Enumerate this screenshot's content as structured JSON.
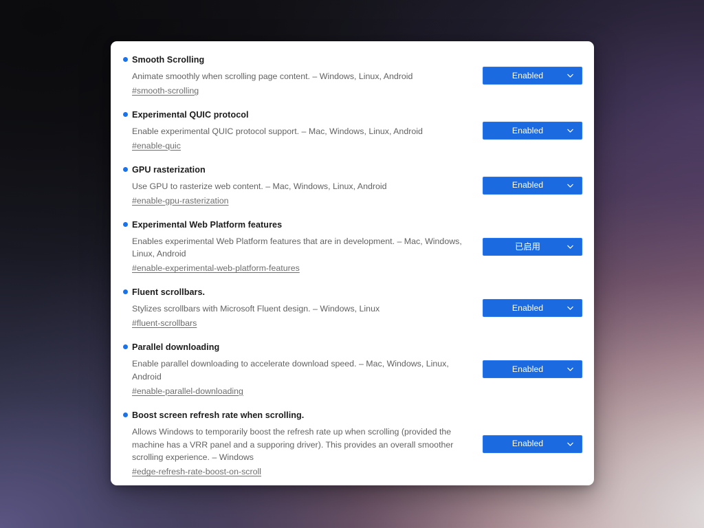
{
  "window": {
    "app": "browser-flags-page",
    "card_background": "#ffffff",
    "accent_blue": "#1b6ae0",
    "bullet_blue": "#1a73e8"
  },
  "wallpaper": {
    "name": "windows-bloom-wallpaper",
    "colors": {
      "top_left": "#141417",
      "bottom_left": "#66609 4",
      "bottom_right": "#fffcfa",
      "mid_right": "#96688c"
    }
  },
  "flags": [
    {
      "title": "Smooth Scrolling",
      "description": "Animate smoothly when scrolling page content. – Windows, Linux, Android",
      "link": "#smooth-scrolling",
      "value": "Enabled",
      "select_name": "smooth-scrolling-select"
    },
    {
      "title": "Experimental QUIC protocol",
      "description": "Enable experimental QUIC protocol support. – Mac, Windows, Linux, Android",
      "link": "#enable-quic",
      "value": "Enabled",
      "select_name": "enable-quic-select"
    },
    {
      "title": "GPU rasterization",
      "description": "Use GPU to rasterize web content. – Mac, Windows, Linux, Android",
      "link": "#enable-gpu-rasterization",
      "value": "Enabled",
      "select_name": "enable-gpu-rasterization-select"
    },
    {
      "title": "Experimental Web Platform features",
      "description": "Enables experimental Web Platform features that are in development. – Mac, Windows, Linux, Android",
      "link": "#enable-experimental-web-platform-features",
      "value": "已启用",
      "select_name": "enable-experimental-web-platform-features-select"
    },
    {
      "title": "Fluent scrollbars.",
      "description": "Stylizes scrollbars with Microsoft Fluent design. – Windows, Linux",
      "link": "#fluent-scrollbars",
      "value": "Enabled",
      "select_name": "fluent-scrollbars-select"
    },
    {
      "title": "Parallel downloading",
      "description": "Enable parallel downloading to accelerate download speed. – Mac, Windows, Linux, Android",
      "link": "#enable-parallel-downloading",
      "value": "Enabled",
      "select_name": "enable-parallel-downloading-select"
    },
    {
      "title": "Boost screen refresh rate when scrolling.",
      "description": "Allows Windows to temporarily boost the refresh rate up when scrolling (provided the machine has a VRR panel and a supporing driver). This provides an overall smoother scrolling experience. – Windows",
      "link": "#edge-refresh-rate-boost-on-scroll",
      "value": "Enabled",
      "select_name": "edge-refresh-rate-boost-on-scroll-select"
    }
  ]
}
